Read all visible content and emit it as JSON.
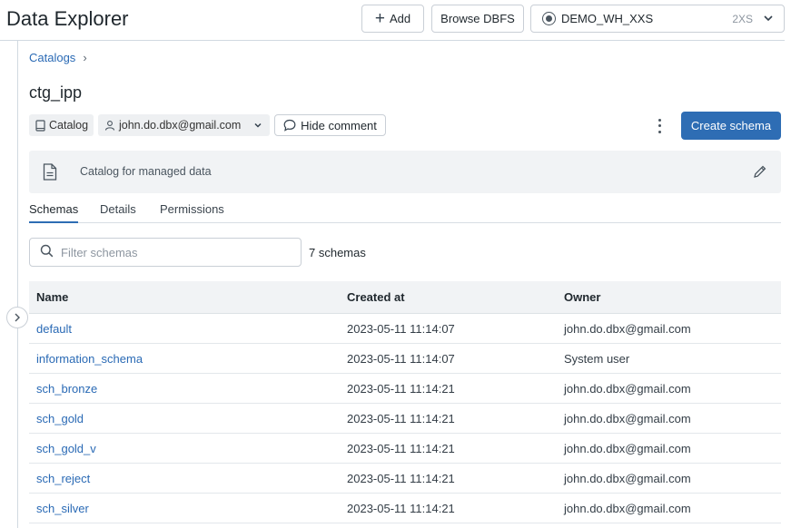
{
  "header": {
    "title": "Data Explorer",
    "add_label": "Add",
    "browse_dbfs_label": "Browse DBFS",
    "warehouse": {
      "name": "DEMO_WH_XXS",
      "size": "2XS"
    }
  },
  "breadcrumb": {
    "root": "Catalogs",
    "separator": "›"
  },
  "catalog": {
    "name": "ctg_ipp",
    "type_tag": "Catalog",
    "owner": "john.do.dbx@gmail.com",
    "hide_comment_label": "Hide comment",
    "create_schema_label": "Create schema",
    "comment": "Catalog for managed data"
  },
  "tabs": [
    {
      "label": "Schemas",
      "active": true
    },
    {
      "label": "Details",
      "active": false
    },
    {
      "label": "Permissions",
      "active": false
    }
  ],
  "filter": {
    "placeholder": "Filter schemas",
    "value": ""
  },
  "schema_count": "7 schemas",
  "table": {
    "columns": [
      "Name",
      "Created at",
      "Owner"
    ],
    "rows": [
      {
        "name": "default",
        "created": "2023-05-11 11:14:07",
        "owner": "john.do.dbx@gmail.com"
      },
      {
        "name": "information_schema",
        "created": "2023-05-11 11:14:07",
        "owner": "System user"
      },
      {
        "name": "sch_bronze",
        "created": "2023-05-11 11:14:21",
        "owner": "john.do.dbx@gmail.com"
      },
      {
        "name": "sch_gold",
        "created": "2023-05-11 11:14:21",
        "owner": "john.do.dbx@gmail.com"
      },
      {
        "name": "sch_gold_v",
        "created": "2023-05-11 11:14:21",
        "owner": "john.do.dbx@gmail.com"
      },
      {
        "name": "sch_reject",
        "created": "2023-05-11 11:14:21",
        "owner": "john.do.dbx@gmail.com"
      },
      {
        "name": "sch_silver",
        "created": "2023-05-11 11:14:21",
        "owner": "john.do.dbx@gmail.com"
      }
    ]
  },
  "icons": {
    "add": "plus-icon",
    "warehouse": "radio-icon",
    "dropdown": "chevron-down-icon",
    "catalog": "book-icon",
    "owner": "user-icon",
    "comment": "speech-bubble-icon",
    "more": "kebab-icon",
    "document": "document-icon",
    "edit": "pencil-icon",
    "search": "search-icon",
    "expand": "chevron-right-icon"
  },
  "colors": {
    "primary": "#2e6db4",
    "link": "#2a6ab5",
    "panel": "#f1f3f5"
  }
}
